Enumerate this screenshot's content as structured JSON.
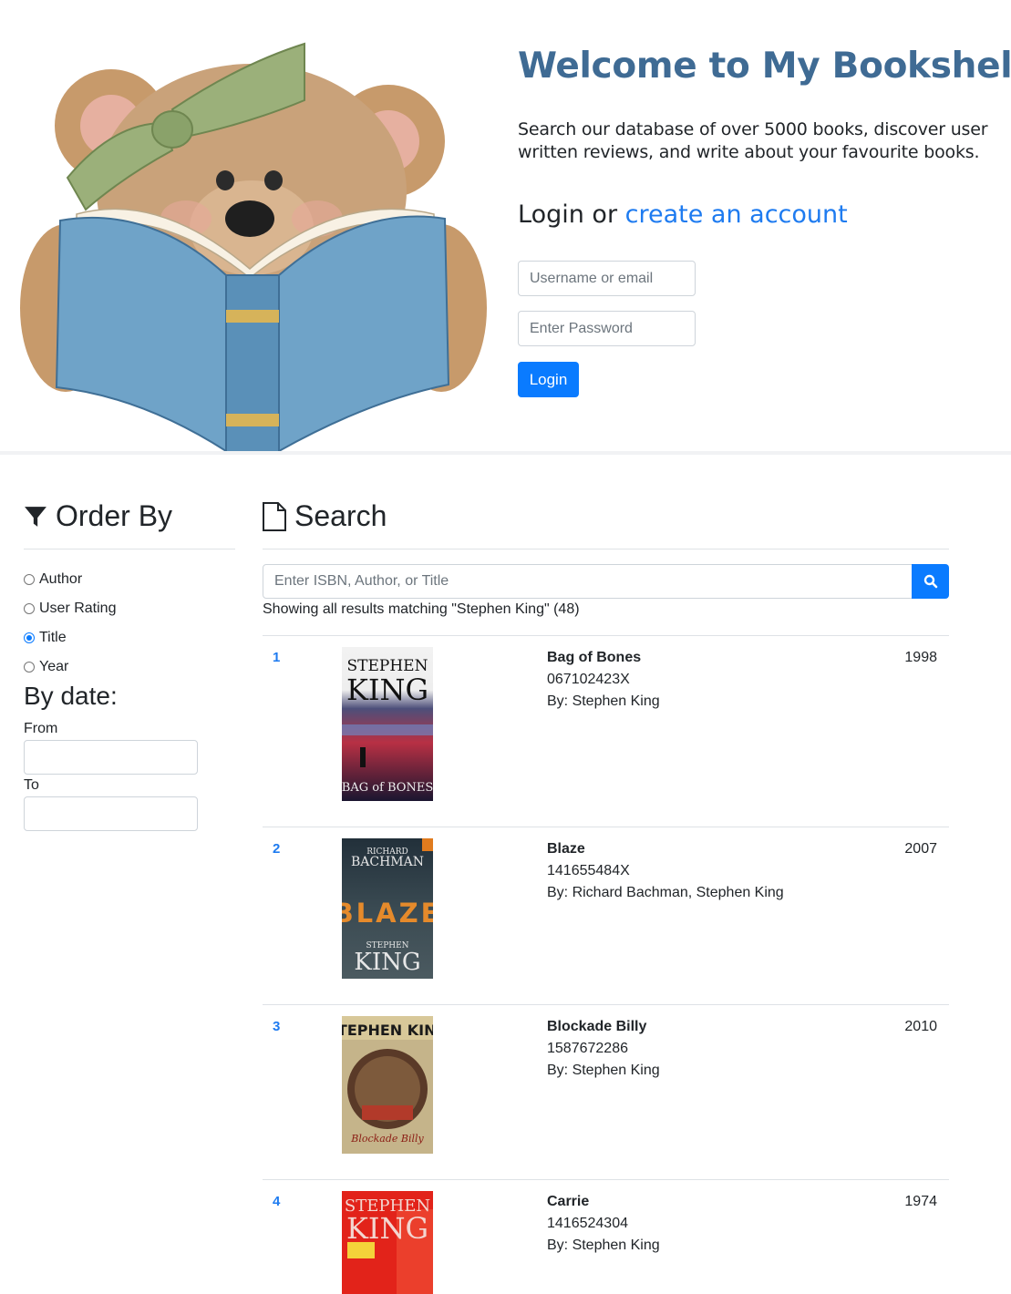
{
  "hero": {
    "welcome_title": "Welcome to My Bookshelf!",
    "tagline": "Search our database of over 5000 books, discover user written reviews, and write about your favourite books.",
    "login_prefix": "Login or ",
    "create_account_link": "create an account",
    "username_placeholder": "Username or email",
    "password_placeholder": "Enter Password",
    "login_button": "Login",
    "illustration": "teddy-bear-reading-book"
  },
  "sidebar": {
    "title": "Order By",
    "title_icon": "filter-icon",
    "options": [
      {
        "label": "Author",
        "selected": false
      },
      {
        "label": "User Rating",
        "selected": false
      },
      {
        "label": "Title",
        "selected": true
      },
      {
        "label": "Year",
        "selected": false
      }
    ],
    "date_heading": "By date:",
    "from_label": "From",
    "to_label": "To",
    "from_value": "",
    "to_value": ""
  },
  "search": {
    "title": "Search",
    "title_icon": "file-icon",
    "placeholder": "Enter ISBN, Author, or Title",
    "button_icon": "search-icon",
    "results_text": "Showing all results matching \"Stephen King\" (48)"
  },
  "results": [
    {
      "rank": "1",
      "title": "Bag of Bones",
      "isbn": "067102423X",
      "by": "By: Stephen King",
      "year": "1998",
      "cover_text": [
        "STEPHEN",
        "KING",
        "BAG of BONES"
      ]
    },
    {
      "rank": "2",
      "title": "Blaze",
      "isbn": "141655484X",
      "by": "By: Richard Bachman, Stephen King",
      "year": "2007",
      "cover_text": [
        "RICHARD",
        "BACHMAN",
        "BLAZE",
        "STEPHEN",
        "KING"
      ]
    },
    {
      "rank": "3",
      "title": "Blockade Billy",
      "isbn": "1587672286",
      "by": "By: Stephen King",
      "year": "2010",
      "cover_text": [
        "STEPHEN KING",
        "Blockade Billy"
      ]
    },
    {
      "rank": "4",
      "title": "Carrie",
      "isbn": "1416524304",
      "by": "By: Stephen King",
      "year": "1974",
      "cover_text": [
        "STEPHEN",
        "KING"
      ]
    }
  ],
  "colors": {
    "brand_blue": "#0a7bff",
    "welcome_blue": "#3f6b94",
    "link_blue": "#1e7bf0"
  }
}
